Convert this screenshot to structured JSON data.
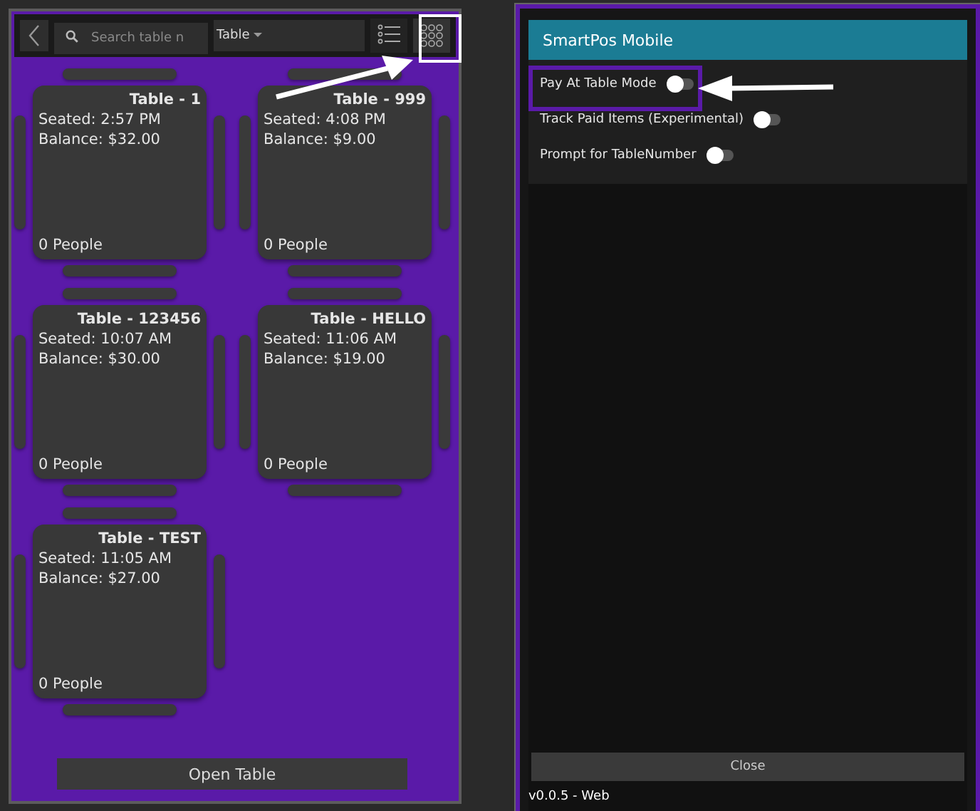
{
  "tables_screen": {
    "search": {
      "placeholder": "Search table n"
    },
    "filter": {
      "value": "Table"
    },
    "view_buttons": [
      {
        "kind": "list",
        "selected": false
      },
      {
        "kind": "grid",
        "selected": true
      }
    ],
    "tables": [
      {
        "name": "Table - 1",
        "seated": "Seated: 2:57 PM",
        "balance": "Balance: $32.00",
        "people": "0 People"
      },
      {
        "name": "Table - 999",
        "seated": "Seated: 4:08 PM",
        "balance": "Balance: $9.00",
        "people": "0 People"
      },
      {
        "name": "Table - 123456",
        "seated": "Seated: 10:07 AM",
        "balance": "Balance: $30.00",
        "people": "0 People"
      },
      {
        "name": "Table - HELLO",
        "seated": "Seated: 11:06 AM",
        "balance": "Balance: $19.00",
        "people": "0 People"
      },
      {
        "name": "Table - TEST",
        "seated": "Seated: 11:05 AM",
        "balance": "Balance: $27.00",
        "people": "0 People"
      }
    ],
    "open_button": "Open Table"
  },
  "settings_dialog": {
    "title": "SmartPos Mobile",
    "settings": [
      {
        "label": "Pay At Table Mode",
        "on": false
      },
      {
        "label": "Track Paid Items (Experimental)",
        "on": false
      },
      {
        "label": "Prompt for TableNumber",
        "on": false
      }
    ],
    "close_button": "Close",
    "version": "v0.0.5 - Web"
  }
}
